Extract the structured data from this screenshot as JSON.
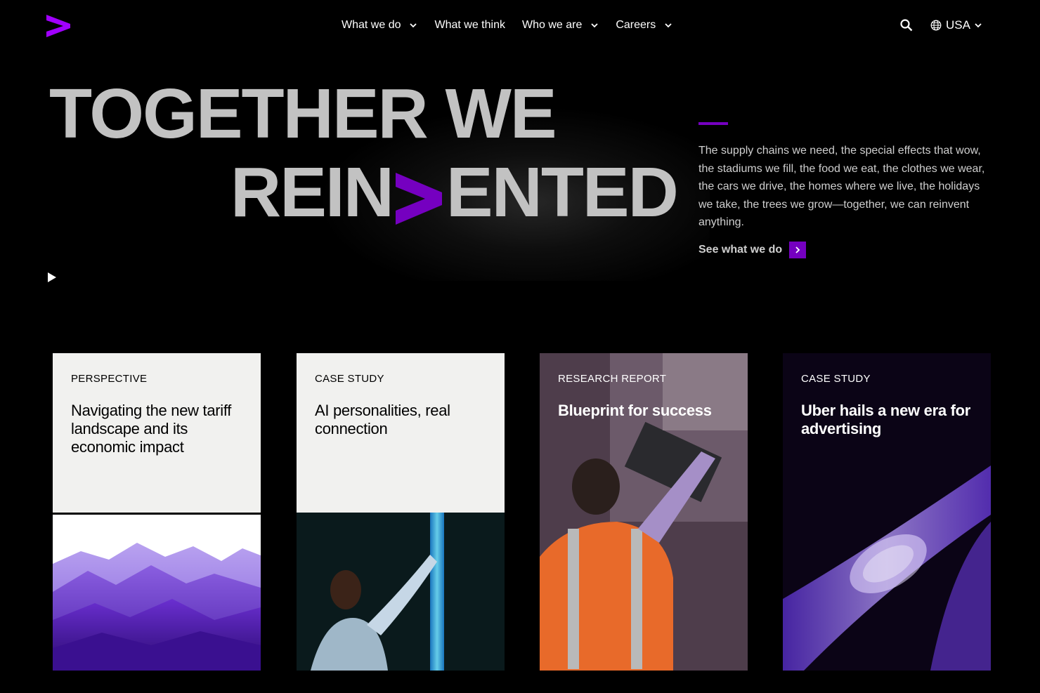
{
  "header": {
    "nav": [
      {
        "label": "What we do",
        "has_dropdown": true
      },
      {
        "label": "What we think",
        "has_dropdown": false
      },
      {
        "label": "Who we are",
        "has_dropdown": true
      },
      {
        "label": "Careers",
        "has_dropdown": true
      }
    ],
    "search_icon": "search-icon",
    "locale": "USA"
  },
  "hero": {
    "line1": "TOGETHER WE",
    "line2_before": "REIN",
    "line2_after": "ENTED",
    "description": "The supply chains we need, the special effects that wow, the stadiums we fill, the food we eat, the clothes we wear, the cars we drive, the homes where we live, the holidays we take, the trees we grow—together, we can reinvent anything.",
    "cta_label": "See what we do"
  },
  "cards": [
    {
      "eyebrow": "PERSPECTIVE",
      "title": "Navigating the new tariff landscape and its economic impact"
    },
    {
      "eyebrow": "CASE STUDY",
      "title": "AI personalities, real connection"
    },
    {
      "eyebrow": "RESEARCH REPORT",
      "title": "Blueprint for success"
    },
    {
      "eyebrow": "CASE STUDY",
      "title": "Uber hails a new era for advertising"
    }
  ],
  "colors": {
    "accent": "#7500c0",
    "background": "#000000",
    "card_light": "#f1f1ef",
    "hero_text": "#c2c2c2"
  }
}
